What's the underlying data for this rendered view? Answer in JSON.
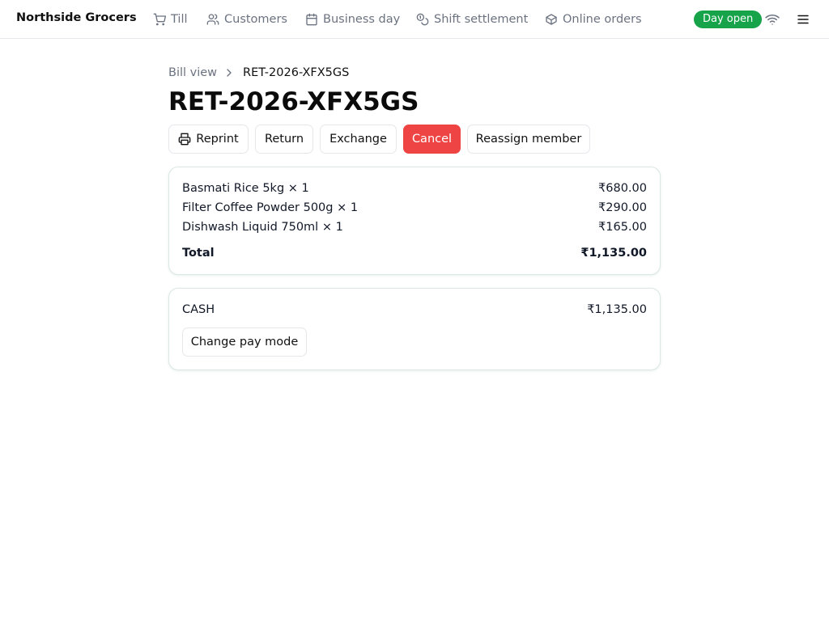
{
  "brand": "Northside Grocers",
  "nav": [
    {
      "label": "Till",
      "icon": "cart-icon"
    },
    {
      "label": "Customers",
      "icon": "users-icon"
    },
    {
      "label": "Business day",
      "icon": "calendar-icon"
    },
    {
      "label": "Shift settlement",
      "icon": "coins-icon"
    },
    {
      "label": "Online orders",
      "icon": "package-icon"
    }
  ],
  "status_badge": "Day open",
  "status_color": "#16a34a",
  "breadcrumb": {
    "parent": "Bill view",
    "current": "RET-2026-XFX5GS"
  },
  "title": "RET-2026-XFX5GS",
  "actions": {
    "reprint": "Reprint",
    "return": "Return",
    "exchange": "Exchange",
    "cancel": "Cancel",
    "reassign": "Reassign member"
  },
  "danger_color": "#ef4444",
  "items": [
    {
      "name": "Basmati Rice 5kg × 1",
      "amount": "₹680.00"
    },
    {
      "name": "Filter Coffee Powder 500g × 1",
      "amount": "₹290.00"
    },
    {
      "name": "Dishwash Liquid 750ml × 1",
      "amount": "₹165.00"
    }
  ],
  "total": {
    "label": "Total",
    "amount": "₹1,135.00"
  },
  "payment": {
    "mode": "CASH",
    "amount": "₹1,135.00",
    "change_label": "Change pay mode"
  }
}
